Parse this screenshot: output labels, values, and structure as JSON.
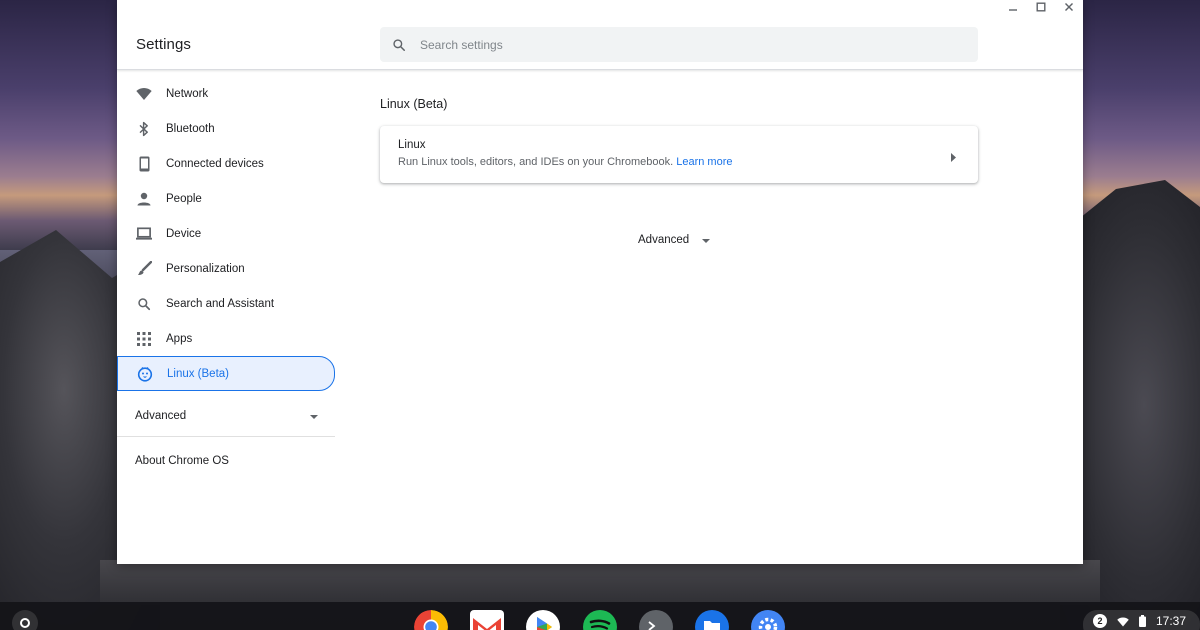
{
  "window": {
    "app_title": "Settings",
    "controls": {
      "minimize": "—",
      "maximize": "□",
      "close": "✕"
    }
  },
  "search": {
    "placeholder": "Search settings"
  },
  "sidebar": {
    "items": [
      {
        "label": "Network",
        "icon": "wifi-icon"
      },
      {
        "label": "Bluetooth",
        "icon": "bluetooth-icon"
      },
      {
        "label": "Connected devices",
        "icon": "phone-icon"
      },
      {
        "label": "People",
        "icon": "person-icon"
      },
      {
        "label": "Device",
        "icon": "laptop-icon"
      },
      {
        "label": "Personalization",
        "icon": "brush-icon"
      },
      {
        "label": "Search and Assistant",
        "icon": "search-icon"
      },
      {
        "label": "Apps",
        "icon": "apps-grid-icon"
      },
      {
        "label": "Linux (Beta)",
        "icon": "penguin-icon",
        "active": true
      }
    ],
    "advanced_label": "Advanced",
    "about_label": "About Chrome OS"
  },
  "main": {
    "section_title": "Linux (Beta)",
    "card": {
      "title": "Linux",
      "description": "Run Linux tools, editors, and IDEs on your Chromebook.",
      "link_label": "Learn more"
    },
    "advanced_label": "Advanced"
  },
  "shelf": {
    "apps": [
      "chrome",
      "gmail",
      "play-store",
      "spotify",
      "terminal",
      "files",
      "settings"
    ],
    "tray": {
      "badge": "2",
      "time": "17:37"
    }
  },
  "colors": {
    "accent": "#1a73e8",
    "active_bg": "#e8f0fe",
    "text_primary": "#202124",
    "text_secondary": "#5f6368",
    "search_bg": "#f1f3f4"
  }
}
